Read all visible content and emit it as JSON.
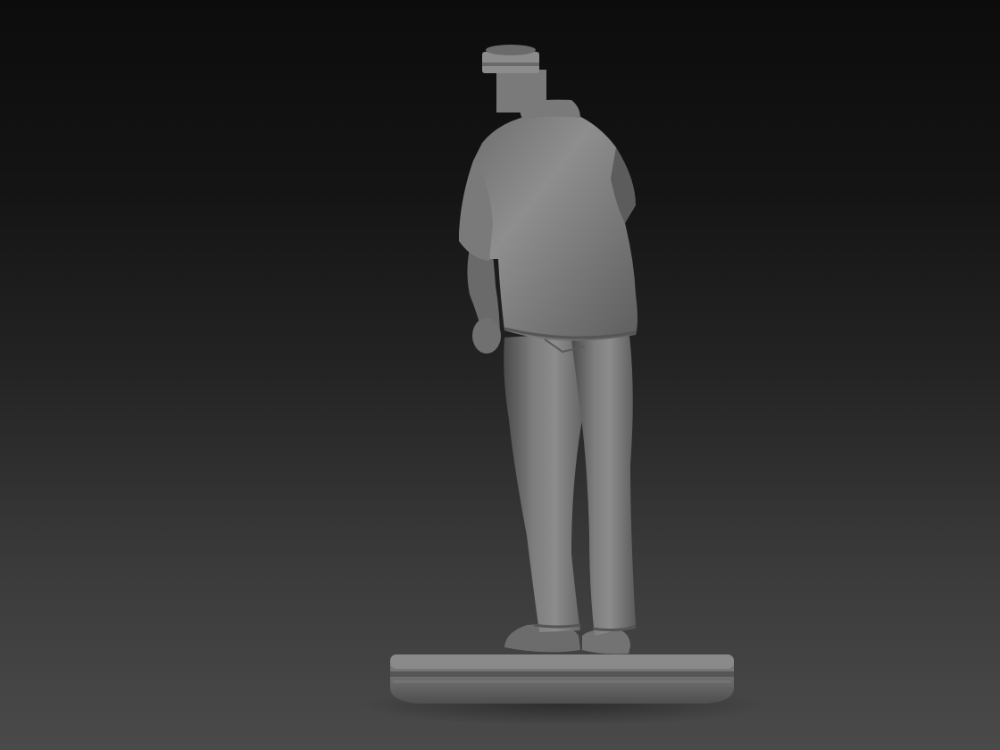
{
  "scene": {
    "subject": "sculpt-model",
    "colors": {
      "background_top": "#0c0c0c",
      "background_bottom": "#4a4a4a",
      "clay_light": "#8c8c8c",
      "clay_mid": "#6e6e6e",
      "clay_dark": "#444444"
    }
  }
}
